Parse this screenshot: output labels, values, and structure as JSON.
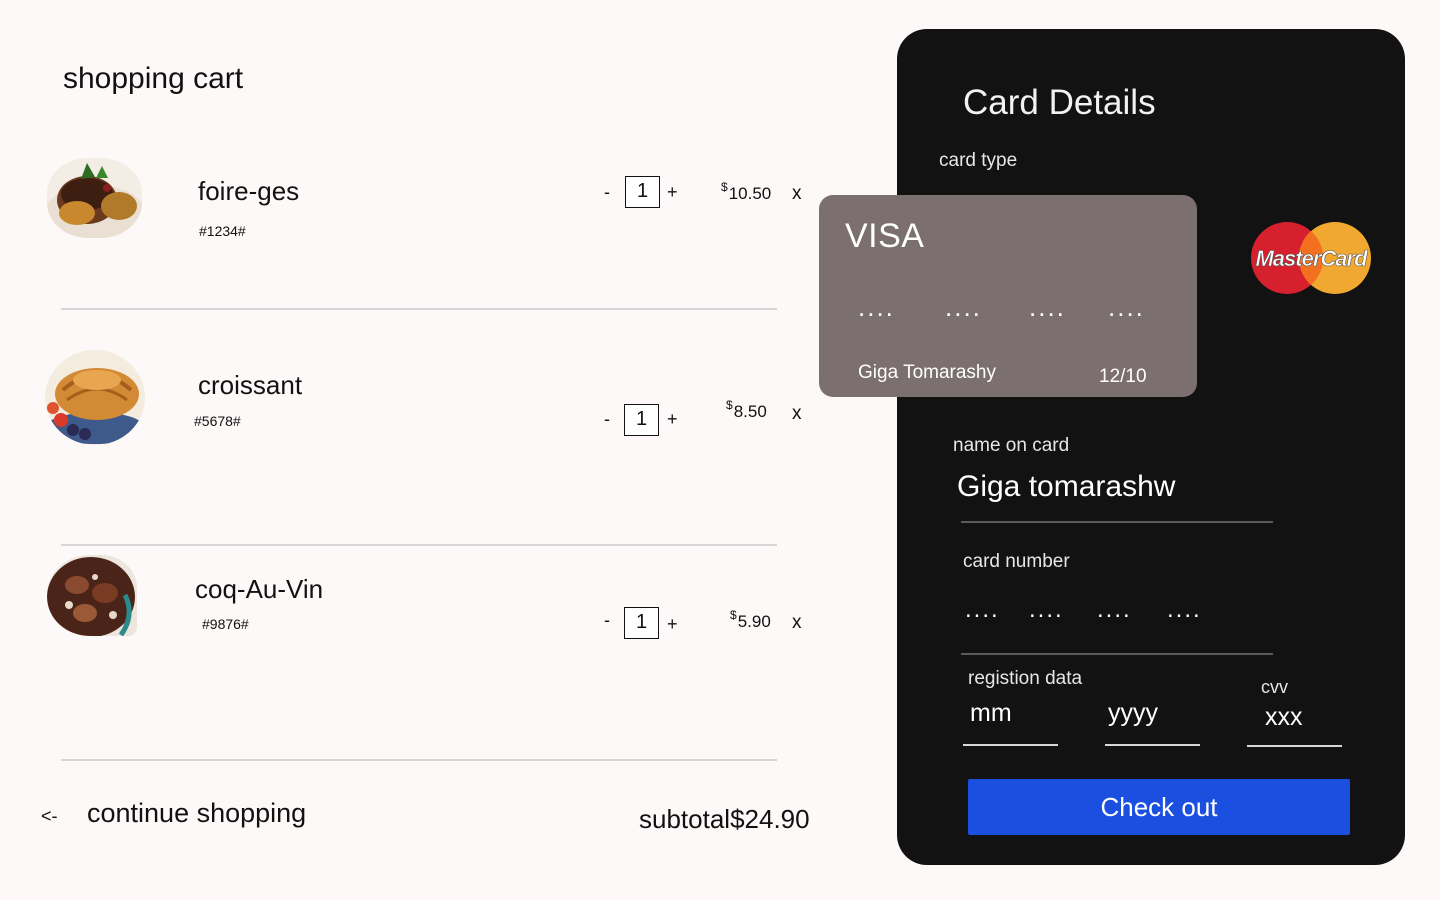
{
  "cart": {
    "title": "shopping cart",
    "items": [
      {
        "name": "foire-ges",
        "sku": "#1234#",
        "quantity": "1",
        "currency": "$",
        "price": "10.50",
        "minus": "-",
        "plus": "+",
        "remove": "x"
      },
      {
        "name": "croissant",
        "sku": "#5678#",
        "quantity": "1",
        "currency": "$",
        "price": "8.50",
        "minus": "-",
        "plus": "+",
        "remove": "x"
      },
      {
        "name": "coq-Au-Vin",
        "sku": "#9876#",
        "quantity": "1",
        "currency": "$",
        "price": "5.90",
        "minus": "-",
        "plus": "+",
        "remove": "x"
      }
    ],
    "back_arrow": "<-",
    "continue_label": "continue shopping",
    "subtotal": "subtotal$24.90"
  },
  "card_panel": {
    "title": "Card Details",
    "card_type_label": "card type",
    "visa_card": {
      "brand": "VISA",
      "number_groups": [
        "....",
        "....",
        "....",
        "...."
      ],
      "holder": "Giga Tomarashy",
      "expiry": "12/10"
    },
    "mastercard_logo_text": "MasterCard",
    "name_label": "name on card",
    "name_value": "Giga tomarashw",
    "number_label": "card  number",
    "number_groups": [
      "....",
      "....",
      "....",
      "...."
    ],
    "date_label": "registion data",
    "month_placeholder": "mm",
    "year_placeholder": "yyyy",
    "cvv_label": "cvv",
    "cvv_placeholder": "xxx",
    "checkout_label": "Check out"
  },
  "colors": {
    "background": "#fdf9f8",
    "panel": "#121212",
    "visa_card": "#7c6f6f",
    "checkout": "#1a4fe0",
    "mastercard_red": "#d6202e",
    "mastercard_yellow": "#f0a830"
  },
  "icons": {
    "item_images": [
      "foie-gras-plate-image",
      "croissant-plate-image",
      "coq-au-vin-dish-image"
    ]
  }
}
